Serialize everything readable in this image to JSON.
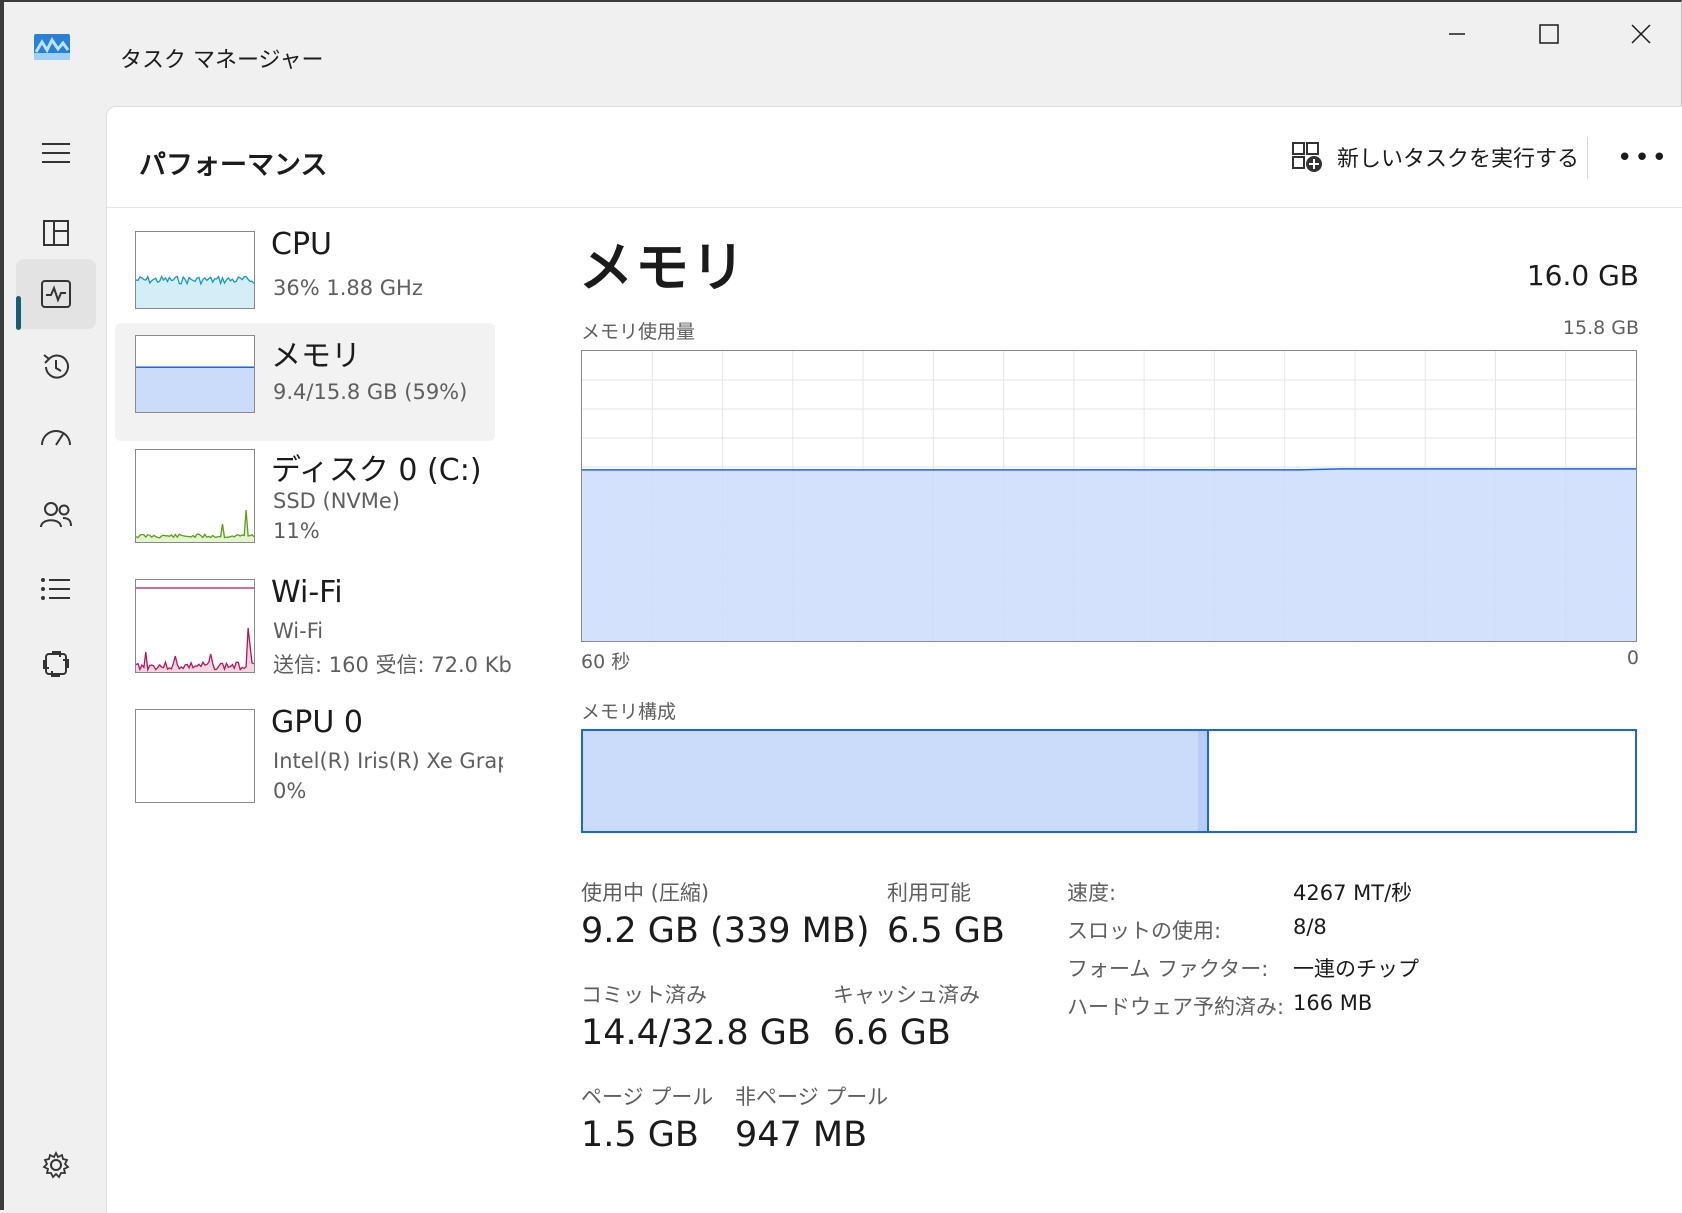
{
  "window": {
    "title": "タスク マネージャー"
  },
  "rail": {
    "items": [
      {
        "name": "hamburger-menu",
        "icon": "hamburger-icon"
      },
      {
        "name": "processes",
        "icon": "processes-icon"
      },
      {
        "name": "performance",
        "icon": "performance-icon",
        "active": true
      },
      {
        "name": "app-history",
        "icon": "history-icon"
      },
      {
        "name": "startup-apps",
        "icon": "startup-icon"
      },
      {
        "name": "users",
        "icon": "users-icon"
      },
      {
        "name": "details",
        "icon": "details-list-icon"
      },
      {
        "name": "services",
        "icon": "services-icon"
      },
      {
        "name": "settings",
        "icon": "gear-icon"
      }
    ]
  },
  "header": {
    "title": "パフォーマンス",
    "run_new_task": "新しいタスクを実行する",
    "more": "•••"
  },
  "devices": [
    {
      "name": "CPU",
      "line1": "36%  1.88 GHz",
      "line2": ""
    },
    {
      "name": "メモリ",
      "line1": "9.4/15.8 GB (59%)",
      "line2": ""
    },
    {
      "name": "ディスク 0 (C:)",
      "line1": "SSD (NVMe)",
      "line2": "11%"
    },
    {
      "name": "Wi-Fi",
      "line1": "Wi-Fi",
      "line2": "送信: 160 受信: 72.0 Kb"
    },
    {
      "name": "GPU 0",
      "line1": "Intel(R) Iris(R) Xe Graphi",
      "line2": "0%"
    }
  ],
  "memory": {
    "title": "メモリ",
    "total": "16.0 GB",
    "usage_label": "メモリ使用量",
    "usage_max": "15.8 GB",
    "time_left": "60 秒",
    "time_right": "0",
    "usage_fraction": 0.59,
    "composition_label": "メモリ構成",
    "composition": {
      "in_use_fraction": 0.585,
      "modified_fraction": 0.008
    },
    "stats": {
      "in_use_label": "使用中 (圧縮)",
      "in_use_value": "9.2 GB (339 MB)",
      "available_label": "利用可能",
      "available_value": "6.5 GB",
      "committed_label": "コミット済み",
      "committed_value": "14.4/32.8 GB",
      "cached_label": "キャッシュ済み",
      "cached_value": "6.6 GB",
      "paged_label": "ページ プール",
      "paged_value": "1.5 GB",
      "nonpaged_label": "非ページ プール",
      "nonpaged_value": "947 MB"
    },
    "properties": [
      {
        "label": "速度:",
        "value": "4267 MT/秒"
      },
      {
        "label": "スロットの使用:",
        "value": "8/8"
      },
      {
        "label": "フォーム ファクター:",
        "value": "一連のチップ"
      },
      {
        "label": "ハードウェア予約済み:",
        "value": "166 MB"
      }
    ]
  },
  "colors": {
    "memory_fill": "#cbdcfb",
    "memory_stroke": "#1a64e6",
    "cpu_stroke": "#1798c1",
    "cpu_fill": "#d4eef7",
    "disk_stroke": "#5f9b1a",
    "disk_fill": "#e4f3d0",
    "wifi_stroke": "#b5175e",
    "wifi_fill": "#f4d6e3",
    "accent": "#0f6173"
  }
}
